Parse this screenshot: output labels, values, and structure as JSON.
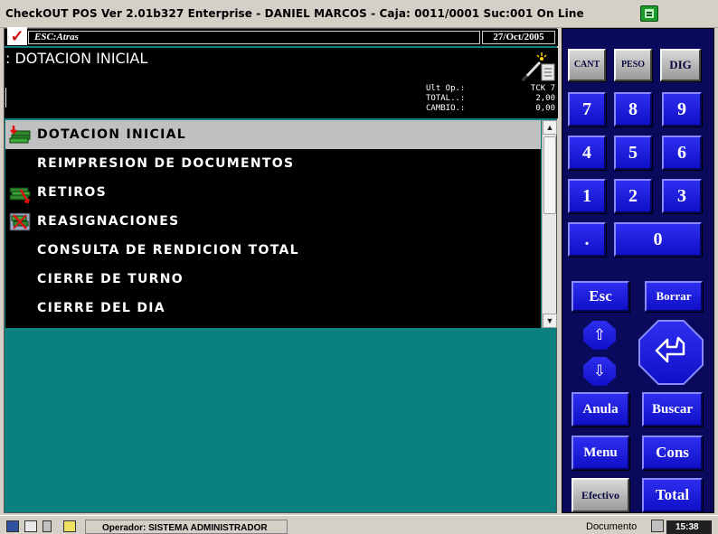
{
  "window": {
    "title": "CheckOUT POS Ver 2.01b327 Enterprise - DANIEL MARCOS - Caja: 0011/0001 Suc:001  On Line"
  },
  "status_strip": {
    "hint": "ESC:Atras",
    "date": "27/Oct/2005"
  },
  "header": {
    "heading": ": DOTACION INICIAL",
    "totals": [
      {
        "label": "Ult Op.:",
        "value": "TCK 7"
      },
      {
        "label": "TOTAL..:",
        "value": "2,00"
      },
      {
        "label": "CAMBIO.:",
        "value": "0,00"
      }
    ]
  },
  "menu": {
    "items": [
      {
        "label": "DOTACION INICIAL",
        "icon": "cash-stack-icon",
        "selected": true
      },
      {
        "label": "REIMPRESION DE DOCUMENTOS",
        "icon": null,
        "selected": false
      },
      {
        "label": "RETIROS",
        "icon": "withdraw-icon",
        "selected": false
      },
      {
        "label": "REASIGNACIONES",
        "icon": "reassign-icon",
        "selected": false
      },
      {
        "label": "CONSULTA DE RENDICION TOTAL",
        "icon": null,
        "selected": false
      },
      {
        "label": "CIERRE DE TURNO",
        "icon": null,
        "selected": false
      },
      {
        "label": "CIERRE DEL DIA",
        "icon": null,
        "selected": false
      }
    ]
  },
  "keypad": {
    "mode_keys": [
      "CANT",
      "PESO",
      "DIG"
    ],
    "digits": [
      "7",
      "8",
      "9",
      "4",
      "5",
      "6",
      "1",
      "2",
      "3"
    ],
    "decimal": ".",
    "zero": "0",
    "esc": "Esc",
    "borrar": "Borrar",
    "up_arrow": "⇧",
    "down_arrow": "⇩",
    "anula": "Anula",
    "buscar": "Buscar",
    "menu": "Menu",
    "cons": "Cons",
    "efectivo": "Efectivo",
    "total": "Total"
  },
  "bottombar": {
    "operator": "Operador: SISTEMA ADMINISTRADOR",
    "document_label": "Documento",
    "clock": "15:38"
  },
  "colors": {
    "teal_bg": "#0a8080",
    "keypad_bg": "#0a0a5c",
    "key_blue": "#1c1ce0",
    "selected_row": "#c0c0c0"
  }
}
